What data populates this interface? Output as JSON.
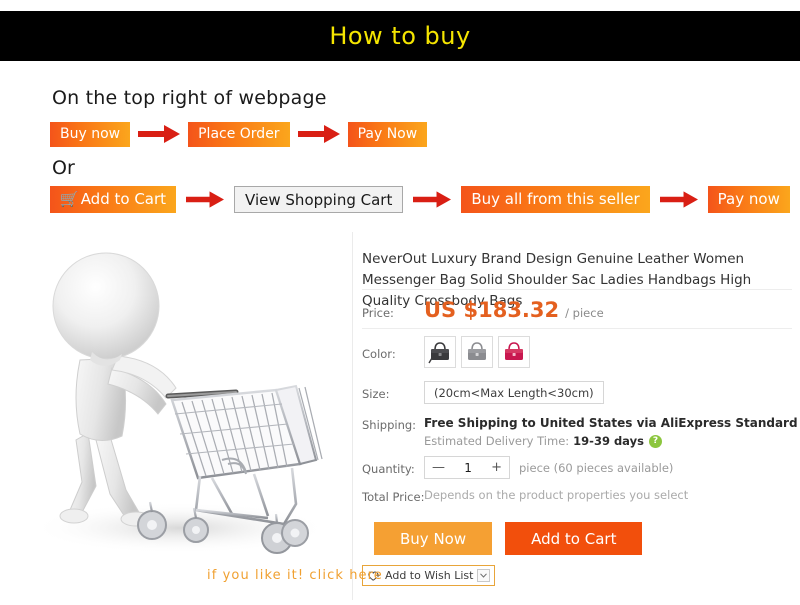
{
  "banner": {
    "title": "How to buy",
    "bg_color": "#000000",
    "text_color": "#f5e500"
  },
  "flow": {
    "heading": "On the top right of webpage",
    "or_label": "Or",
    "path_one": [
      {
        "label": "Buy now",
        "style": "orange"
      },
      {
        "label": "Place Order",
        "style": "orange"
      },
      {
        "label": "Pay Now",
        "style": "orange"
      }
    ],
    "path_two": [
      {
        "label": "Add to Cart",
        "style": "orange",
        "icon": "shopping-cart-icon"
      },
      {
        "label": "View Shopping Cart",
        "style": "gray"
      },
      {
        "label": "Buy all from this seller",
        "style": "orange"
      },
      {
        "label": "Pay now",
        "style": "orange"
      }
    ],
    "arrow_color": "#d91f14",
    "button_gradient_from": "#f4541a",
    "button_gradient_to": "#fba61c"
  },
  "photo": {
    "alt": "3d-figure-pushing-shopping-cart",
    "like_text": "if you like it! click here"
  },
  "product": {
    "title": "NeverOut Luxury Brand Design Genuine Leather Women Messenger Bag Solid Shoulder Sac Ladies Handbags High Quality Crossbody Bags",
    "price_label": "Price:",
    "price_value": "US $183.32",
    "price_unit": "/ piece",
    "price_color": "#e4601f",
    "color_label": "Color:",
    "colors": [
      {
        "name": "black",
        "hex": "#3a3a3c"
      },
      {
        "name": "gray",
        "hex": "#8b8c90"
      },
      {
        "name": "rose-red",
        "hex": "#c8174f"
      }
    ],
    "size_label": "Size:",
    "size_value": "(20cm<Max Length<30cm)",
    "shipping_label": "Shipping:",
    "shipping_value": "Free Shipping to United States via AliExpress Standard Shipping",
    "eta_label": "Estimated Delivery Time:",
    "eta_value": "19-39 days",
    "help_glyph": "?",
    "quantity_label": "Quantity:",
    "quantity_minus": "—",
    "quantity_value": "1",
    "quantity_plus": "+",
    "quantity_note": "piece (60 pieces available)",
    "total_label": "Total Price:",
    "total_value": "Depends on the product properties you select",
    "buy_now_label": "Buy Now",
    "add_to_cart_label": "Add to Cart",
    "wish_label": "Add to Wish List",
    "buy_now_color": "#f5a033",
    "add_cart_color": "#f24f0c"
  }
}
